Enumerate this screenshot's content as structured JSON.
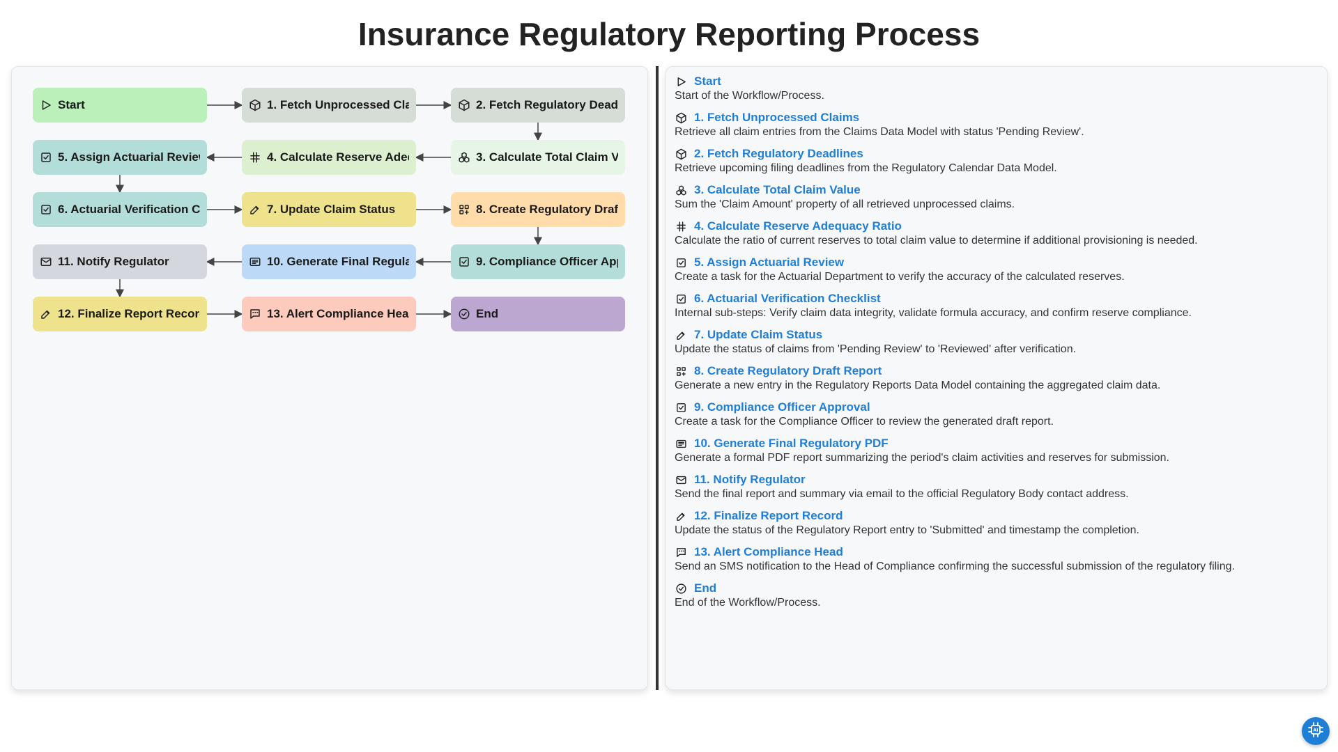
{
  "title": "Insurance Regulatory Reporting Process",
  "colors": {
    "start": "#bbf0bb",
    "gray": "#d6ddd6",
    "lightgreen": "#dcefcf",
    "palegreen": "#e6f5e6",
    "teal": "#b3ddd8",
    "yellow": "#efe28c",
    "peach": "#ffdcaa",
    "slate": "#d4d8de",
    "blue": "#bcdaf7",
    "salmon": "#fccbbd",
    "purple": "#bca7d0",
    "link": "#1f7fd6"
  },
  "nodes": [
    {
      "id": "start",
      "label": "Start",
      "icon": "play-icon",
      "color": "#bbf0bb"
    },
    {
      "id": "n1",
      "label": "1. Fetch Unprocessed Claims",
      "icon": "cube-icon",
      "color": "#d6ddd6"
    },
    {
      "id": "n2",
      "label": "2. Fetch Regulatory Deadlines",
      "icon": "cube-icon",
      "color": "#d6ddd6"
    },
    {
      "id": "n3",
      "label": "3. Calculate Total Claim Value",
      "icon": "cubes-icon",
      "color": "#e6f5e6"
    },
    {
      "id": "n4",
      "label": "4. Calculate Reserve Adequacy Ratio",
      "icon": "hash-icon",
      "color": "#dcefcf"
    },
    {
      "id": "n5",
      "label": "5. Assign Actuarial Review",
      "icon": "checkbox-icon",
      "color": "#b3ddd8"
    },
    {
      "id": "n6",
      "label": "6. Actuarial Verification Checklist",
      "icon": "checkbox-icon",
      "color": "#b3ddd8"
    },
    {
      "id": "n7",
      "label": "7. Update Claim Status",
      "icon": "edit-icon",
      "color": "#efe28c"
    },
    {
      "id": "n8",
      "label": "8. Create Regulatory Draft Report",
      "icon": "grid-plus-icon",
      "color": "#ffdcaa"
    },
    {
      "id": "n9",
      "label": "9. Compliance Officer Approval",
      "icon": "checkbox-icon",
      "color": "#b3ddd8"
    },
    {
      "id": "n10",
      "label": "10. Generate Final Regulatory PDF",
      "icon": "document-icon",
      "color": "#bcdaf7"
    },
    {
      "id": "n11",
      "label": "11. Notify Regulator",
      "icon": "mail-icon",
      "color": "#d4d8de"
    },
    {
      "id": "n12",
      "label": "12. Finalize Report Record",
      "icon": "edit-icon",
      "color": "#efe28c"
    },
    {
      "id": "n13",
      "label": "13. Alert Compliance Head",
      "icon": "sms-icon",
      "color": "#fccbbd"
    },
    {
      "id": "end",
      "label": "End",
      "icon": "check-circle-icon",
      "color": "#bca7d0"
    }
  ],
  "details": [
    {
      "title": "Start",
      "icon": "play-icon",
      "desc": "Start of the Workflow/Process."
    },
    {
      "title": "1. Fetch Unprocessed Claims",
      "icon": "cube-icon",
      "desc": "Retrieve all claim entries from the Claims Data Model with status 'Pending Review'."
    },
    {
      "title": "2. Fetch Regulatory Deadlines",
      "icon": "cube-icon",
      "desc": "Retrieve upcoming filing deadlines from the Regulatory Calendar Data Model."
    },
    {
      "title": "3. Calculate Total Claim Value",
      "icon": "cubes-icon",
      "desc": "Sum the 'Claim Amount' property of all retrieved unprocessed claims."
    },
    {
      "title": "4. Calculate Reserve Adequacy Ratio",
      "icon": "hash-icon",
      "desc": "Calculate the ratio of current reserves to total claim value to determine if additional provisioning is needed."
    },
    {
      "title": "5. Assign Actuarial Review",
      "icon": "checkbox-icon",
      "desc": "Create a task for the Actuarial Department to verify the accuracy of the calculated reserves."
    },
    {
      "title": "6. Actuarial Verification Checklist",
      "icon": "checkbox-icon",
      "desc": "Internal sub-steps: Verify claim data integrity, validate formula accuracy, and confirm reserve compliance."
    },
    {
      "title": "7. Update Claim Status",
      "icon": "edit-icon",
      "desc": "Update the status of claims from 'Pending Review' to 'Reviewed' after verification."
    },
    {
      "title": "8. Create Regulatory Draft Report",
      "icon": "grid-plus-icon",
      "desc": "Generate a new entry in the Regulatory Reports Data Model containing the aggregated claim data."
    },
    {
      "title": "9. Compliance Officer Approval",
      "icon": "checkbox-icon",
      "desc": "Create a task for the Compliance Officer to review the generated draft report."
    },
    {
      "title": "10. Generate Final Regulatory PDF",
      "icon": "document-icon",
      "desc": "Generate a formal PDF report summarizing the period's claim activities and reserves for submission."
    },
    {
      "title": "11. Notify Regulator",
      "icon": "mail-icon",
      "desc": "Send the final report and summary via email to the official Regulatory Body contact address."
    },
    {
      "title": "12. Finalize Report Record",
      "icon": "edit-icon",
      "desc": "Update the status of the Regulatory Report entry to 'Submitted' and timestamp the completion."
    },
    {
      "title": "13. Alert Compliance Head",
      "icon": "sms-icon",
      "desc": "Send an SMS notification to the Head of Compliance confirming the successful submission of the regulatory filing."
    },
    {
      "title": "End",
      "icon": "check-circle-icon",
      "desc": "End of the Workflow/Process."
    }
  ],
  "fab_icon": "ai-chip-icon"
}
